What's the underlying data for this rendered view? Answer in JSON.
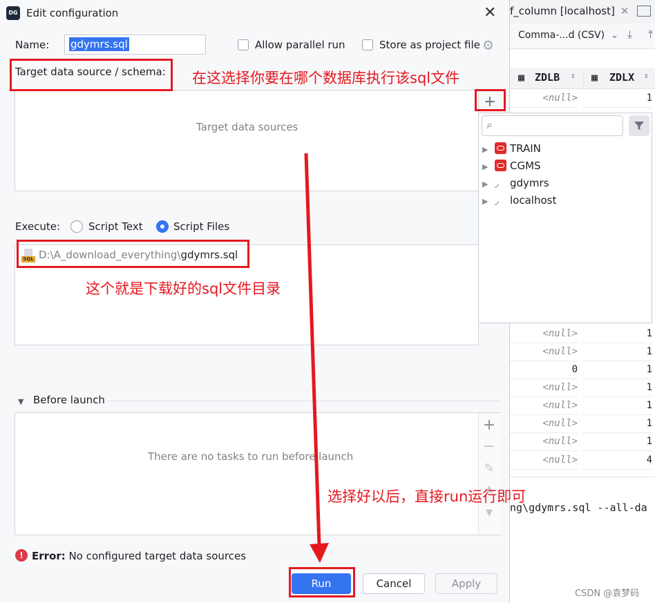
{
  "background_ide": {
    "tab_title": "f_column [localhost]",
    "export_format": "Comma-...d (CSV)",
    "columns": [
      "ZDLB",
      "ZDLX"
    ],
    "rows": [
      [
        "<null>",
        "1"
      ],
      [
        "<null>",
        "1"
      ],
      [
        "<null>",
        "1"
      ],
      [
        "0",
        "1"
      ],
      [
        "<null>",
        "1"
      ],
      [
        "<null>",
        "1"
      ],
      [
        "<null>",
        "1"
      ],
      [
        "<null>",
        "1"
      ],
      [
        "<null>",
        "4"
      ]
    ],
    "console_line": "ng\\gdymrs.sql --all-da",
    "watermark": "CSDN @袁梦码"
  },
  "dialog": {
    "logo_text": "DG",
    "title": "Edit configuration",
    "name_label": "Name:",
    "name_value": "gdymrs.sql",
    "allow_parallel_label": "Allow parallel run",
    "store_project_label": "Store as project file",
    "target_label": "Target data source / schema:",
    "target_placeholder": "Target data sources",
    "execute_label": "Execute:",
    "script_text_label": "Script Text",
    "script_files_label": "Script Files",
    "file_icon_text": "SQL",
    "file_path_dir": "D:\\A_download_everything\\",
    "file_path_name": "gdymrs.sql",
    "before_launch_label": "Before launch",
    "before_launch_empty": "There are no tasks to run before launch",
    "error_prefix": "Error:",
    "error_message": "No configured target data sources",
    "run_label": "Run",
    "cancel_label": "Cancel",
    "apply_label": "Apply"
  },
  "datasource_popup": {
    "items": [
      {
        "name": "TRAIN",
        "icon": "oracle-icon"
      },
      {
        "name": "CGMS",
        "icon": "oracle-icon"
      },
      {
        "name": "gdymrs",
        "icon": "mysql-icon"
      },
      {
        "name": "localhost",
        "icon": "mysql-icon"
      }
    ]
  },
  "annotations": {
    "target_note": "在这选择你要在哪个数据库执行该sql文件",
    "file_note": "这个就是下载好的sql文件目录",
    "run_note": "选择好以后，直接run运行即可"
  },
  "colors": {
    "accent": "#3574f0",
    "annotation_red": "#e5181f",
    "oracle_red": "#e02a2a"
  }
}
